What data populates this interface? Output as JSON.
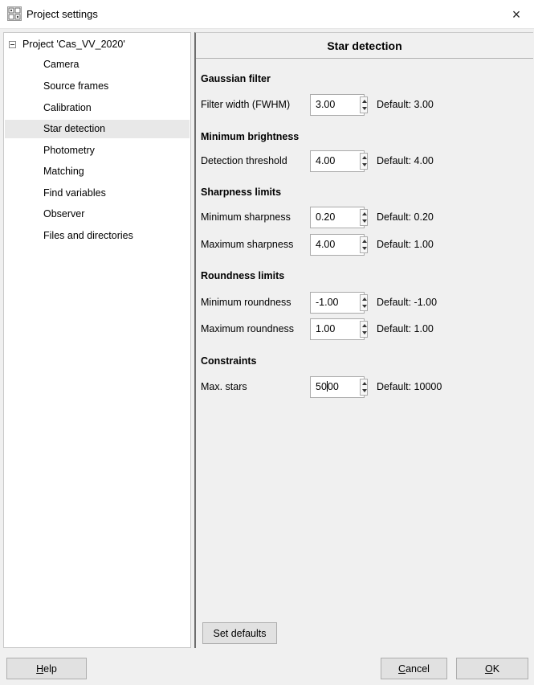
{
  "window": {
    "title": "Project settings",
    "app_icon": "project-settings-icon",
    "close_glyph": "×"
  },
  "tree": {
    "root_label": "Project 'Cas_VV_2020'",
    "items": [
      {
        "label": "Camera"
      },
      {
        "label": "Source frames"
      },
      {
        "label": "Calibration"
      },
      {
        "label": "Star detection",
        "selected": true
      },
      {
        "label": "Photometry"
      },
      {
        "label": "Matching"
      },
      {
        "label": "Find variables"
      },
      {
        "label": "Observer"
      },
      {
        "label": "Files and directories"
      }
    ]
  },
  "panel": {
    "title": "Star detection",
    "sections": {
      "gaussian": {
        "title": "Gaussian filter",
        "filter_width": {
          "label": "Filter width (FWHM)",
          "value": "3.00",
          "default": "Default: 3.00"
        }
      },
      "brightness": {
        "title": "Minimum brightness",
        "detection_threshold": {
          "label": "Detection threshold",
          "value": "4.00",
          "default": "Default: 4.00"
        }
      },
      "sharpness": {
        "title": "Sharpness limits",
        "min": {
          "label": "Minimum sharpness",
          "value": "0.20",
          "default": "Default: 0.20"
        },
        "max": {
          "label": "Maximum sharpness",
          "value": "4.00",
          "default": "Default: 1.00"
        }
      },
      "roundness": {
        "title": "Roundness limits",
        "min": {
          "label": "Minimum roundness",
          "value": "-1.00",
          "default": "Default: -1.00"
        },
        "max": {
          "label": "Maximum roundness",
          "value": "1.00",
          "default": "Default: 1.00"
        }
      },
      "constraints": {
        "title": "Constraints",
        "max_stars": {
          "label": "Max. stars",
          "value_before_caret": "50",
          "value_after_caret": "00",
          "default": "Default: 10000"
        }
      }
    },
    "set_defaults_label": "Set defaults"
  },
  "buttons": {
    "help": {
      "mnemonic": "H",
      "rest": "elp"
    },
    "cancel": {
      "mnemonic": "C",
      "rest": "ancel"
    },
    "ok": {
      "mnemonic": "O",
      "rest": "K"
    }
  }
}
